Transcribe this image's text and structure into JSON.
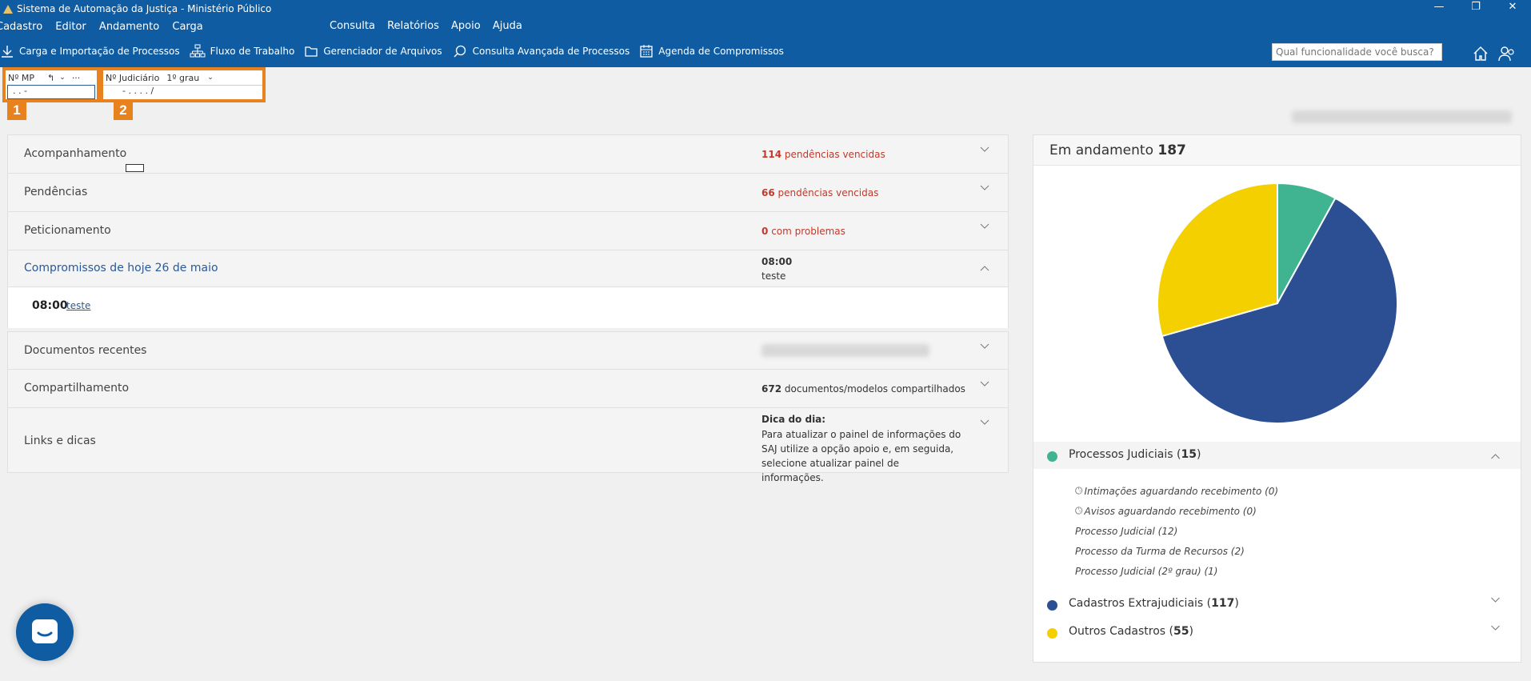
{
  "window": {
    "title": "Sistema de Automação da Justiça - Ministério Público",
    "controls": [
      "—",
      "❐",
      "✕"
    ]
  },
  "menu": {
    "left": [
      "Cadastro",
      "Editor",
      "Andamento",
      "Carga"
    ],
    "right": [
      "Consulta",
      "Relatórios",
      "Apoio",
      "Ajuda"
    ]
  },
  "toolbar": {
    "items": [
      {
        "label": "Carga e Importação de Processos",
        "icon": "download-icon"
      },
      {
        "label": "Fluxo de Trabalho",
        "icon": "workflow-icon"
      },
      {
        "label": "Gerenciador de Arquivos",
        "icon": "folder-icon"
      },
      {
        "label": "Consulta Avançada de Processos",
        "icon": "search-doc-icon"
      },
      {
        "label": "Agenda de Compromissos",
        "icon": "calendar-icon"
      }
    ],
    "search_placeholder": "Qual funcionalidade você busca?"
  },
  "fields": {
    "mp": {
      "label": "Nº MP",
      "mask": ". .     -",
      "badge": "1",
      "more": "···"
    },
    "judiciario": {
      "label": "Nº Judiciário",
      "grau": "1º grau",
      "mask": "- .   . . .   /",
      "badge": "2"
    }
  },
  "panels": [
    {
      "title": "Acompanhamento",
      "count": "114",
      "summary": "pendências vencidas"
    },
    {
      "title": "Pendências",
      "count": "66",
      "summary": "pendências vencidas"
    },
    {
      "title": "Peticionamento",
      "count": "0",
      "summary": "com problemas"
    },
    {
      "title": "Compromissos de hoje 26 de maio",
      "time": "08:00",
      "summary": "teste",
      "item_time": "08:00",
      "item_link": "teste"
    },
    {
      "title": "Documentos recentes"
    },
    {
      "title": "Compartilhamento",
      "count": "672",
      "summary": "documentos/modelos compartilhados"
    },
    {
      "title": "Links e dicas",
      "tip_title": "Dica do dia:",
      "tip_text": "Para atualizar o painel de informações do SAJ utilize a opção apoio e, em seguida, selecione atualizar painel de informações."
    }
  ],
  "right_panel": {
    "header_label": "Em andamento",
    "header_count": "187",
    "legend": [
      {
        "name": "Processos Judiciais",
        "count": "15",
        "color": "#40b491"
      },
      {
        "name": "Cadastros Extrajudiciais",
        "count": "117",
        "color": "#2c4f93"
      },
      {
        "name": "Outros Cadastros",
        "count": "55",
        "color": "#f4d000"
      }
    ],
    "sub_items": [
      "Intimações aguardando recebimento (0)",
      "Avisos aguardando recebimento (0)",
      "Processo Judicial (12)",
      "Processo da Turma de Recursos (2)",
      "Processo Judicial (2º grau) (1)"
    ]
  },
  "chart_data": {
    "type": "pie",
    "categories": [
      "Processos Judiciais",
      "Cadastros Extrajudiciais",
      "Outros Cadastros"
    ],
    "values": [
      15,
      117,
      55
    ],
    "colors": [
      "#40b491",
      "#2c4f93",
      "#f4d000"
    ],
    "title": "Em andamento 187"
  }
}
